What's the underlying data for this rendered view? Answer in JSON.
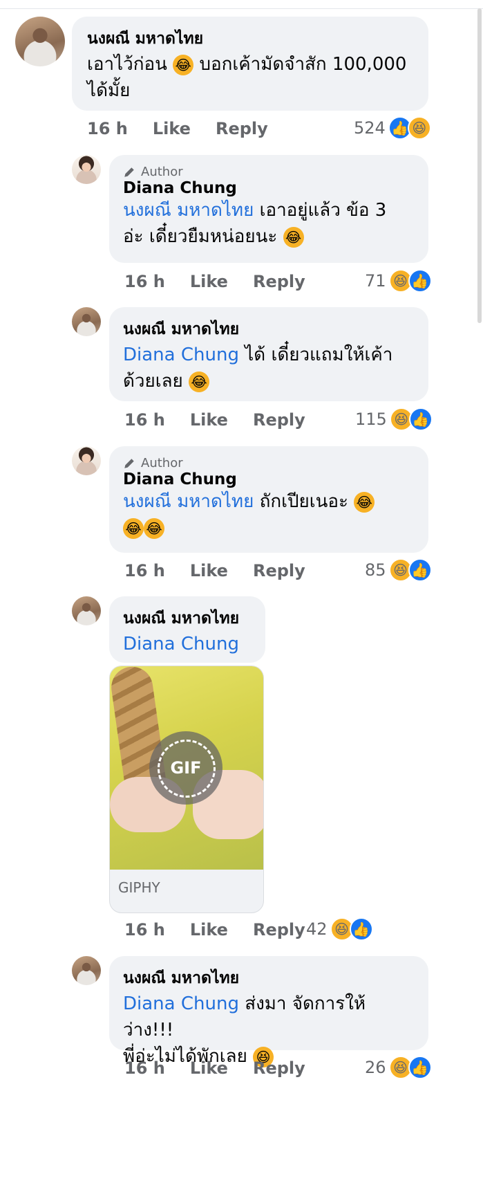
{
  "comments": [
    {
      "name": "นงผณี มหาดไทย",
      "text_plain": "เอาไว้ก่อน",
      "text_after": "บอกเค้ามัดจำสัก 100,000",
      "text_line2": "ได้มั้ย",
      "time": "16 h",
      "like": "Like",
      "reply": "Reply",
      "count": "524"
    },
    {
      "author_badge": "Author",
      "name": "Diana Chung",
      "mention": "นงผณี มหาดไทย",
      "text_line1": "เอาอยู่แล้ว ข้อ 3",
      "text_line2": "อ่ะ เดี๋ยวยืมหน่อยนะ",
      "time": "16 h",
      "like": "Like",
      "reply": "Reply",
      "count": "71"
    },
    {
      "name": "นงผณี มหาดไทย",
      "mention": "Diana Chung",
      "text_line1": "ได้ เดี๋ยวแถมให้เค้า",
      "text_line2": "ด้วยเลย",
      "time": "16 h",
      "like": "Like",
      "reply": "Reply",
      "count": "115"
    },
    {
      "author_badge": "Author",
      "name": "Diana Chung",
      "mention": "นงผณี มหาดไทย",
      "text_line1": "ถักเปียเนอะ",
      "time": "16 h",
      "like": "Like",
      "reply": "Reply",
      "count": "85"
    },
    {
      "name": "นงผณี มหาดไทย",
      "mention": "Diana Chung",
      "gif_label": "GIF",
      "gif_source": "GIPHY",
      "time": "16 h",
      "like": "Like",
      "reply": "Reply",
      "count": "42"
    },
    {
      "name": "นงผณี มหาดไทย",
      "mention": "Diana Chung",
      "text_line1": "ส่งมา จัดการให้ ว่าง!!!",
      "text_line2": "พี่อ่ะไม่ได้พักเลย",
      "time": "16 h",
      "like": "Like",
      "reply": "Reply",
      "count": "26"
    }
  ],
  "icons": {
    "haha": "haha-reaction-icon",
    "like": "like-reaction-icon",
    "pencil": "pencil-icon"
  },
  "colors": {
    "bubble": "#f0f2f5",
    "mention": "#216fdb",
    "meta": "#65676b",
    "like_blue": "#1877f2",
    "haha_yellow": "#f7b125"
  }
}
